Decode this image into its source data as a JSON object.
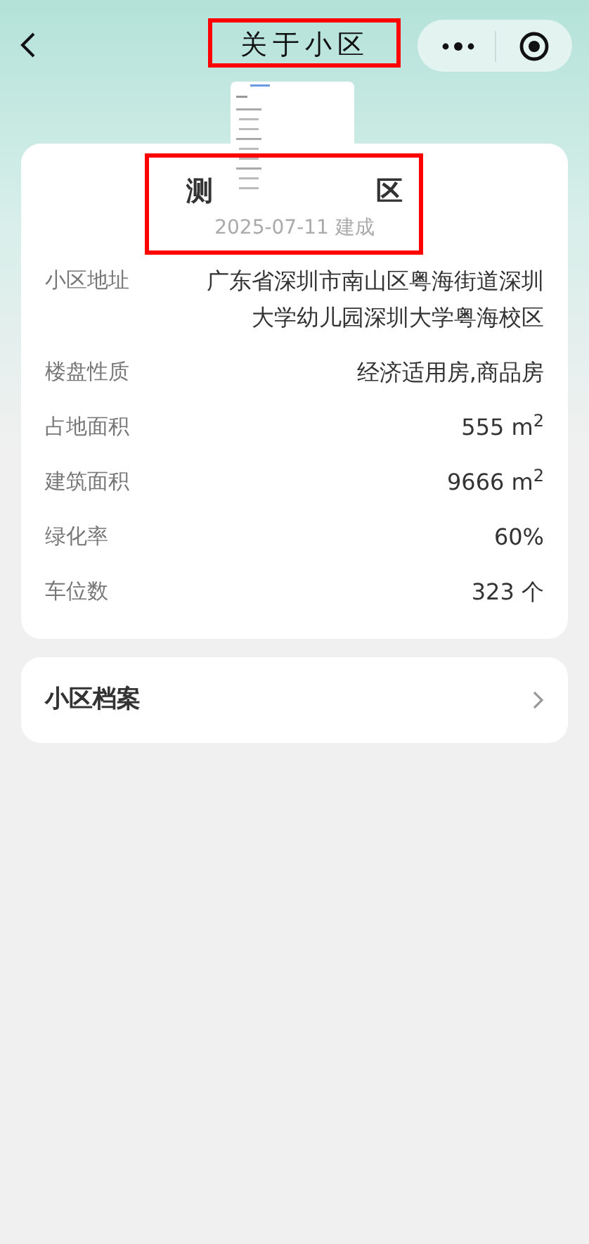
{
  "nav": {
    "title": "关于小区"
  },
  "summary": {
    "title_start": "测",
    "title_end": "区",
    "built": "2025-07-11 建成"
  },
  "details": [
    {
      "label": "小区地址",
      "value": "广东省深圳市南山区粤海街道深圳大学幼儿园深圳大学粤海校区"
    },
    {
      "label": "楼盘性质",
      "value": "经济适用房,商品房"
    },
    {
      "label": "占地面积",
      "value": "555 m$^{2}$"
    },
    {
      "label": "建筑面积",
      "value": "9666 m$^{2}$"
    },
    {
      "label": "绿化率",
      "value": "60%"
    },
    {
      "label": "车位数",
      "value": "323 个"
    }
  ],
  "links": [
    {
      "label": "小区档案"
    }
  ]
}
